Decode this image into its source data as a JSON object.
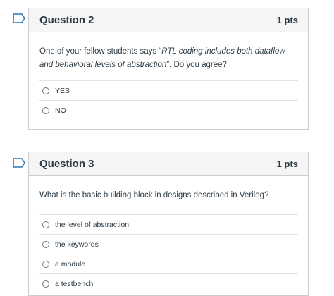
{
  "questions": [
    {
      "title": "Question 2",
      "points": "1 pts",
      "text_before": "One of your fellow students says “",
      "text_italic": "RTL coding includes both dataflow and behavioral levels of abstraction",
      "text_after": "”. Do you agree?",
      "flag_icon": "bookmark-flag-icon",
      "answers": [
        "YES",
        "NO"
      ]
    },
    {
      "title": "Question 3",
      "points": "1 pts",
      "text": "What is the basic building block in designs described in Verilog?",
      "flag_icon": "bookmark-flag-icon",
      "answers": [
        "the level of abstraction",
        "the keywords",
        "a module",
        "a testbench"
      ]
    }
  ],
  "colors": {
    "flag_outline": "#2b7abc",
    "header_bg": "#f5f5f5",
    "border": "#c7cdd1",
    "text": "#2d3b45"
  }
}
